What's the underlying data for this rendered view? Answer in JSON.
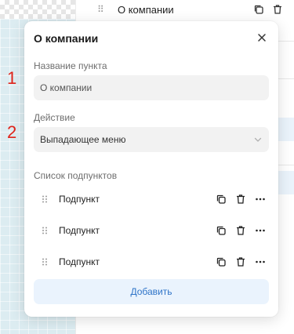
{
  "background": {
    "row_label": "О компании"
  },
  "annotations": [
    "1",
    "2"
  ],
  "popup": {
    "title": "О компании",
    "name_field": {
      "label": "Название пункта",
      "value": "О компании"
    },
    "action_field": {
      "label": "Действие",
      "value": "Выпадающее меню"
    },
    "subitems": {
      "label": "Список подпунктов",
      "items": [
        {
          "label": "Подпункт"
        },
        {
          "label": "Подпункт"
        },
        {
          "label": "Подпункт"
        }
      ]
    },
    "add_button": "Добавить"
  },
  "colors": {
    "accent": "#2f74c8",
    "accent_bg": "#eaf3fd",
    "annotation": "#e0241b",
    "grid_bg": "#dcecf1"
  }
}
